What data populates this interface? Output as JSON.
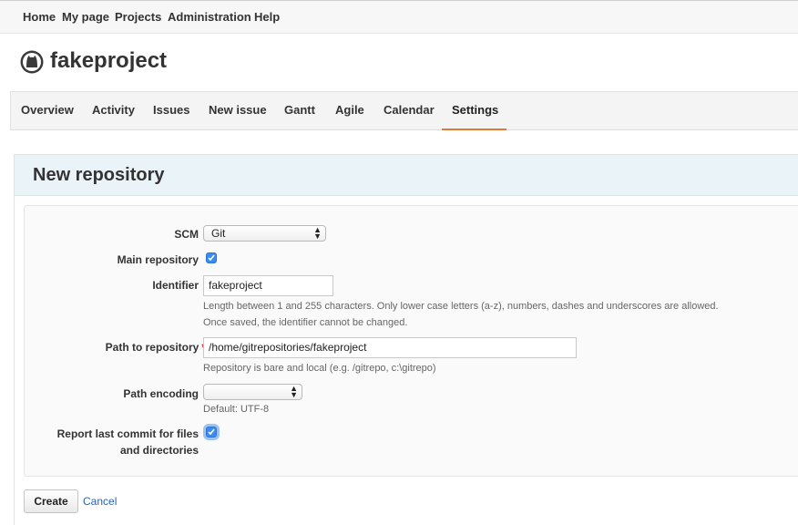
{
  "top_menu": {
    "items": [
      "Home",
      "My page",
      "Projects",
      "Administration",
      "Help"
    ]
  },
  "project": {
    "logo_icon": "octocat-logo-icon",
    "name": "fakeproject"
  },
  "tabs": {
    "items": [
      "Overview",
      "Activity",
      "Issues",
      "New issue",
      "Gantt",
      "Agile",
      "Calendar",
      "Settings"
    ],
    "active": "Settings",
    "active_color": "#e07a33"
  },
  "form": {
    "title": "New repository",
    "scm": {
      "label": "SCM",
      "value": "Git"
    },
    "main_repository": {
      "label": "Main repository",
      "checked": true
    },
    "identifier": {
      "label": "Identifier",
      "value": "fakeproject",
      "hint1": "Length between 1 and 255 characters. Only lower case letters (a-z), numbers, dashes and underscores are allowed.",
      "hint2": "Once saved, the identifier cannot be changed."
    },
    "path": {
      "label": "Path to repository",
      "required_marker": "*",
      "value": "/home/gitrepositories/fakeproject",
      "hint": "Repository is bare and local (e.g. /gitrepo, c:\\gitrepo)"
    },
    "encoding": {
      "label": "Path encoding",
      "value": "",
      "hint": "Default: UTF-8"
    },
    "report_last_commit": {
      "label_line1": "Report last commit for files",
      "label_line2": "and directories",
      "checked": true
    },
    "create_label": "Create",
    "cancel_label": "Cancel"
  }
}
